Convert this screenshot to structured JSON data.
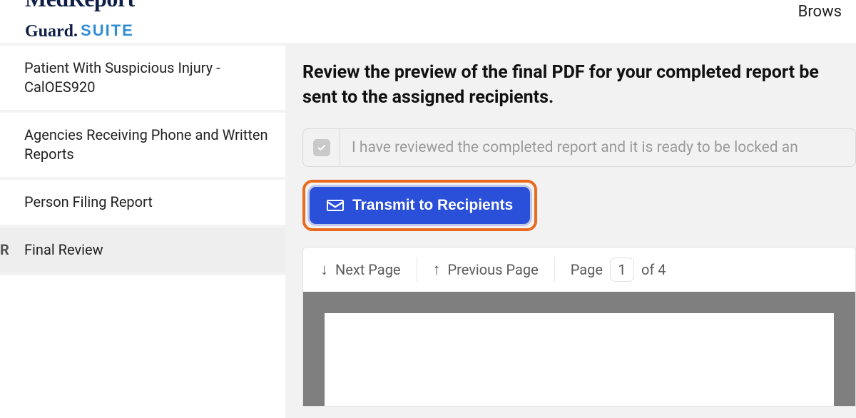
{
  "brand": {
    "line1": "MedReport",
    "line2": "Guard.",
    "suite": "SUITE"
  },
  "header": {
    "browse": "Brows"
  },
  "sidebar": {
    "items": [
      {
        "label": "Patient With Suspicious Injury - CalOES920",
        "marker": ""
      },
      {
        "label": "Agencies Receiving Phone and Written Reports",
        "marker": ""
      },
      {
        "label": "Person Filing Report",
        "marker": ""
      },
      {
        "label": "Final Review",
        "marker": "R"
      }
    ]
  },
  "main": {
    "heading": "Review the preview of the final PDF for your completed report be sent to the assigned recipients.",
    "ack_text": "I have reviewed the completed report and it is ready to be locked an",
    "transmit_label": "Transmit to Recipients"
  },
  "pdf": {
    "next_label": "Next Page",
    "prev_label": "Previous Page",
    "page_word": "Page",
    "current_page": "1",
    "of_total": "of 4"
  }
}
